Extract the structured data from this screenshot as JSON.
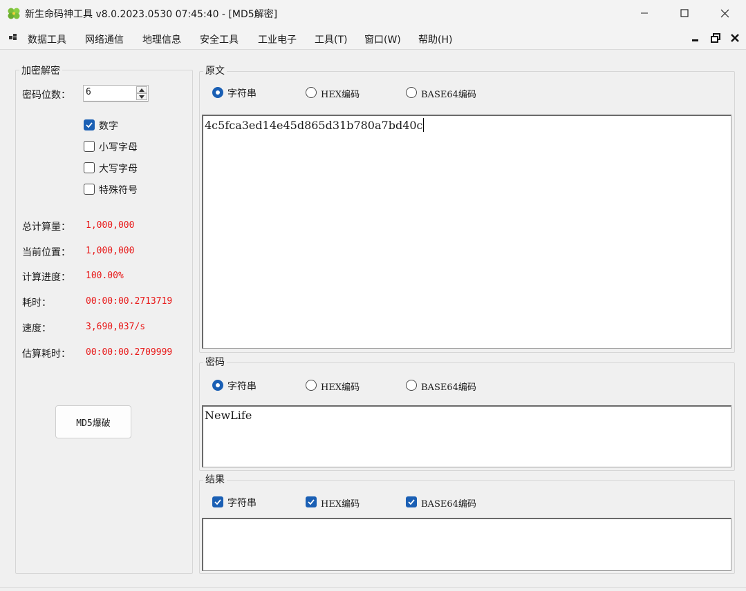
{
  "window": {
    "title": "新生命码神工具 v8.0.2023.0530 07:45:40 - [MD5解密]",
    "icon": "clover-icon"
  },
  "menu": {
    "items": [
      "数据工具",
      "网络通信",
      "地理信息",
      "安全工具",
      "工业电子",
      "工具(T)",
      "窗口(W)",
      "帮助(H)"
    ]
  },
  "left_panel": {
    "group_title": "加密解密",
    "password_digits_label": "密码位数：",
    "password_digits_value": "6",
    "charset_options": [
      {
        "label": "数字",
        "checked": true
      },
      {
        "label": "小写字母",
        "checked": false
      },
      {
        "label": "大写字母",
        "checked": false
      },
      {
        "label": "特殊符号",
        "checked": false
      }
    ],
    "stats": [
      {
        "label": "总计算量：",
        "value": "1,000,000"
      },
      {
        "label": "当前位置：",
        "value": "1,000,000"
      },
      {
        "label": "计算进度：",
        "value": "100.00%"
      },
      {
        "label": "耗时：",
        "value": "00:00:00.2713719"
      },
      {
        "label": "速度：",
        "value": "3,690,037/s"
      },
      {
        "label": "估算耗时：",
        "value": "00:00:00.2709999"
      }
    ],
    "crack_button": "MD5爆破"
  },
  "original": {
    "group_title": "原文",
    "options": [
      {
        "label": "字符串",
        "selected": true
      },
      {
        "label": "HEX编码",
        "selected": false
      },
      {
        "label": "BASE64编码",
        "selected": false
      }
    ],
    "content": "4c5fca3ed14e45d865d31b780a7bd40c"
  },
  "password": {
    "group_title": "密码",
    "options": [
      {
        "label": "字符串",
        "selected": true
      },
      {
        "label": "HEX编码",
        "selected": false
      },
      {
        "label": "BASE64编码",
        "selected": false
      }
    ],
    "content": "NewLife"
  },
  "result": {
    "group_title": "结果",
    "options": [
      {
        "label": "字符串",
        "checked": true
      },
      {
        "label": "HEX编码",
        "checked": true
      },
      {
        "label": "BASE64编码",
        "checked": true
      }
    ],
    "content": ""
  },
  "colors": {
    "accent": "#1a5fb4",
    "stat_value": "#e81818"
  }
}
